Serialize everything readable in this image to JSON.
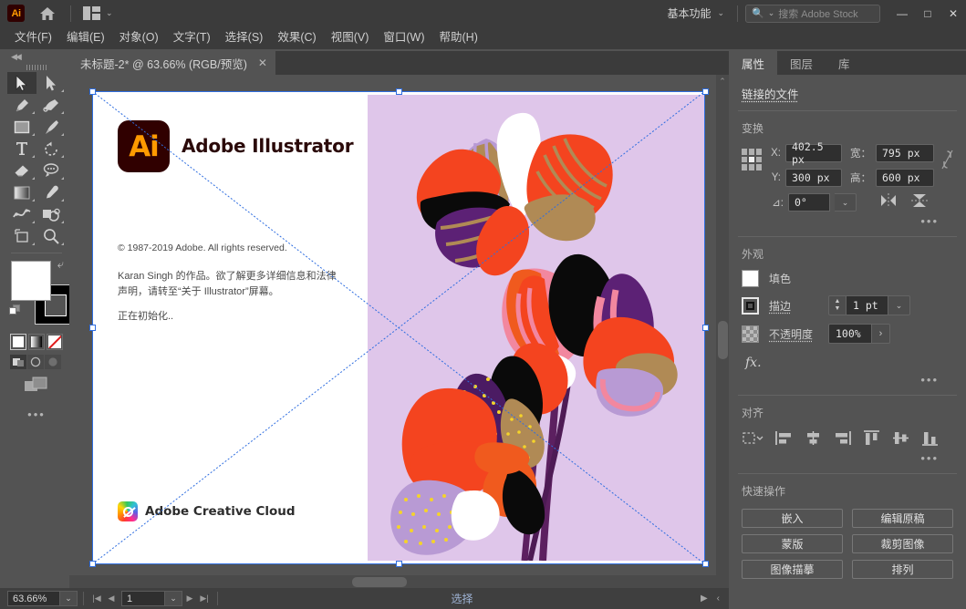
{
  "titlebar": {
    "app_icon": "ai-logo-icon",
    "home_icon": "home-icon",
    "arrange_icon": "arrange-documents-icon",
    "workspace": "基本功能",
    "search_placeholder": "搜索 Adobe Stock",
    "minimize": "—",
    "maximize": "□",
    "close": "✕"
  },
  "menubar": {
    "items": [
      {
        "label": "文件(F)"
      },
      {
        "label": "编辑(E)"
      },
      {
        "label": "对象(O)"
      },
      {
        "label": "文字(T)"
      },
      {
        "label": "选择(S)"
      },
      {
        "label": "效果(C)"
      },
      {
        "label": "视图(V)"
      },
      {
        "label": "窗口(W)"
      },
      {
        "label": "帮助(H)"
      }
    ]
  },
  "toolbar": {
    "tools": [
      {
        "name": "selection-tool",
        "selected": true
      },
      {
        "name": "direct-selection-tool",
        "selected": false
      },
      {
        "name": "pen-tool",
        "selected": false
      },
      {
        "name": "curvature-tool",
        "selected": false
      },
      {
        "name": "rectangle-tool",
        "selected": false
      },
      {
        "name": "paintbrush-tool",
        "selected": false
      },
      {
        "name": "type-tool",
        "selected": false
      },
      {
        "name": "rotate-tool",
        "selected": false
      },
      {
        "name": "eraser-tool",
        "selected": false
      },
      {
        "name": "lasso-tool",
        "selected": false
      },
      {
        "name": "gradient-tool",
        "selected": false
      },
      {
        "name": "eyedropper-tool",
        "selected": false
      },
      {
        "name": "width-tool",
        "selected": false
      },
      {
        "name": "shape-builder-tool",
        "selected": false
      },
      {
        "name": "artboard-tool",
        "selected": false
      },
      {
        "name": "zoom-tool",
        "selected": false
      }
    ],
    "fill_color": "#ffffff",
    "stroke_color": "#000000",
    "modes": [
      "color-swatch",
      "gradient-swatch",
      "none-swatch"
    ],
    "draw_modes": [
      "draw-normal",
      "draw-behind",
      "draw-inside"
    ],
    "screen_mode": "change-screen-mode",
    "more_tools": "•••"
  },
  "document": {
    "tab_title": "未标题-2* @ 63.66% (RGB/预览)",
    "close_glyph": "✕"
  },
  "splash": {
    "product_initials": "Ai",
    "product_name": "Adobe Illustrator",
    "copyright": "© 1987-2019 Adobe. All rights reserved.",
    "credit": "Karan Singh 的作品。欲了解更多详细信息和法律声明，请转至“关于 Illustrator”屏幕。",
    "status": "正在初始化..",
    "cc_label": "Adobe Creative Cloud"
  },
  "artwork": {
    "background": "#dfc6ea",
    "palette": {
      "orange_red": "#f4441f",
      "orange": "#f05a1e",
      "black": "#0a0a0a",
      "white": "#ffffff",
      "tan": "#b08a55",
      "purple_dark": "#5c2175",
      "purple_stem": "#5c2060",
      "lavender": "#b89ad4",
      "pink": "#f2879f",
      "yellow_dot": "#f4d32a"
    }
  },
  "statusbar": {
    "zoom_value": "63.66%",
    "zoom_chevron": "⌄",
    "nav_first": "|◀",
    "nav_prev": "◀",
    "page_value": "1",
    "page_chevron": "⌄",
    "nav_next": "▶",
    "nav_last": "▶|",
    "status_text": "选择",
    "play_glyph": "▶",
    "collapse_glyph": "‹"
  },
  "panel": {
    "tabs": [
      {
        "label": "属性",
        "active": true
      },
      {
        "label": "图层",
        "active": false
      },
      {
        "label": "库",
        "active": false
      }
    ],
    "title": "链接的文件",
    "transform": {
      "heading": "变换",
      "x_label": "X:",
      "x_value": "402.5 px",
      "y_label": "Y:",
      "y_value": "300 px",
      "w_label": "宽：",
      "w_value": "795 px",
      "h_label": "高：",
      "h_value": "600 px",
      "angle_label": "⊿:",
      "angle_value": "0°",
      "link_icon": "constrain-proportions-icon",
      "flip_h_icon": "flip-horizontal-icon",
      "flip_v_icon": "flip-vertical-icon",
      "more": "•••"
    },
    "appearance": {
      "heading": "外观",
      "fill_label": "填色",
      "fill_color": "#ffffff",
      "stroke_label": "描边",
      "stroke_value": "1 pt",
      "opacity_label": "不透明度",
      "opacity_value": "100%",
      "fx_label": "fx.",
      "more": "•••"
    },
    "align": {
      "heading": "对齐",
      "icons": [
        "align-to-selection-icon",
        "align-left-icon",
        "align-horizontal-center-icon",
        "align-right-icon",
        "align-top-icon",
        "align-vertical-center-icon",
        "align-bottom-icon"
      ],
      "more": "•••"
    },
    "quick_actions": {
      "heading": "快速操作",
      "buttons": [
        {
          "label": "嵌入"
        },
        {
          "label": "编辑原稿"
        },
        {
          "label": "蒙版"
        },
        {
          "label": "裁剪图像"
        },
        {
          "label": "图像描摹"
        },
        {
          "label": "排列"
        }
      ]
    }
  },
  "colors": {
    "chrome_dark": "#3b3b3b",
    "chrome_mid": "#535353",
    "field_bg": "#2f2f2f",
    "selection_blue": "#2f6ee0",
    "status_blue": "#9fb4d6"
  }
}
